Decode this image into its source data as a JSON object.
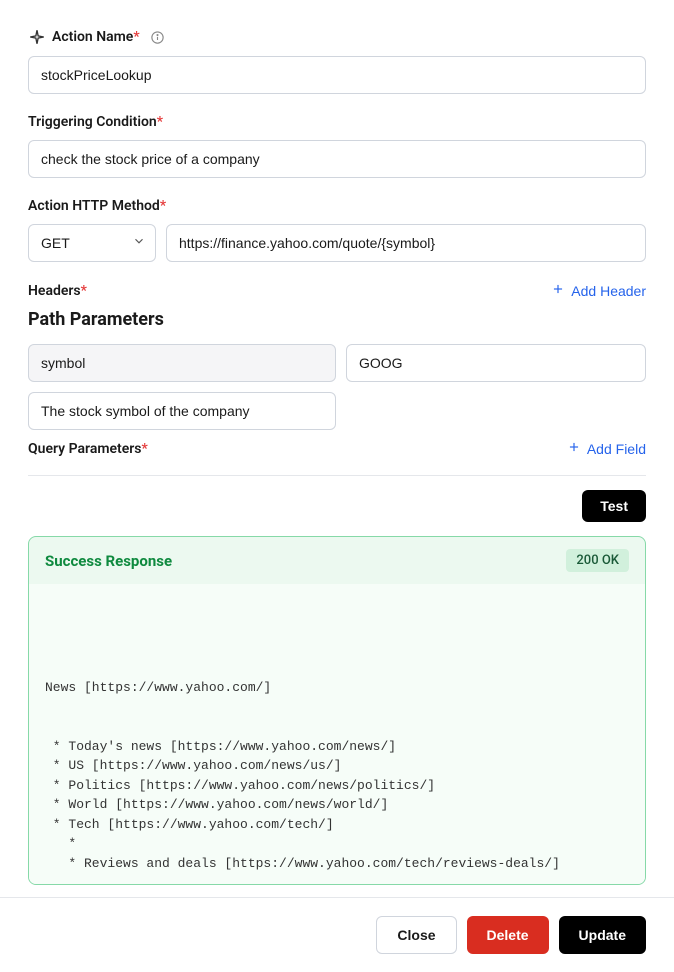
{
  "actionName": {
    "label": "Action Name",
    "value": "stockPriceLookup"
  },
  "triggeringCondition": {
    "label": "Triggering Condition",
    "value": "check the stock price of a company"
  },
  "httpMethod": {
    "label": "Action HTTP Method",
    "selected": "GET",
    "url": "https://finance.yahoo.com/quote/{symbol}"
  },
  "headers": {
    "label": "Headers",
    "addLabel": "Add Header"
  },
  "pathParams": {
    "title": "Path Parameters",
    "name": "symbol",
    "value": "GOOG",
    "description": "The stock symbol of the company"
  },
  "queryParams": {
    "label": "Query Parameters",
    "addLabel": "Add Field"
  },
  "test": {
    "label": "Test"
  },
  "response": {
    "title": "Success Response",
    "status": "200 OK",
    "body": "\n\n\n\nNews [https://www.yahoo.com/]\n\n\n * Today's news [https://www.yahoo.com/news/]\n * US [https://www.yahoo.com/news/us/]\n * Politics [https://www.yahoo.com/news/politics/]\n * World [https://www.yahoo.com/news/world/]\n * Tech [https://www.yahoo.com/tech/]\n   *\n   * Reviews and deals [https://www.yahoo.com/tech/reviews-deals/]"
  },
  "footer": {
    "close": "Close",
    "delete": "Delete",
    "update": "Update"
  }
}
